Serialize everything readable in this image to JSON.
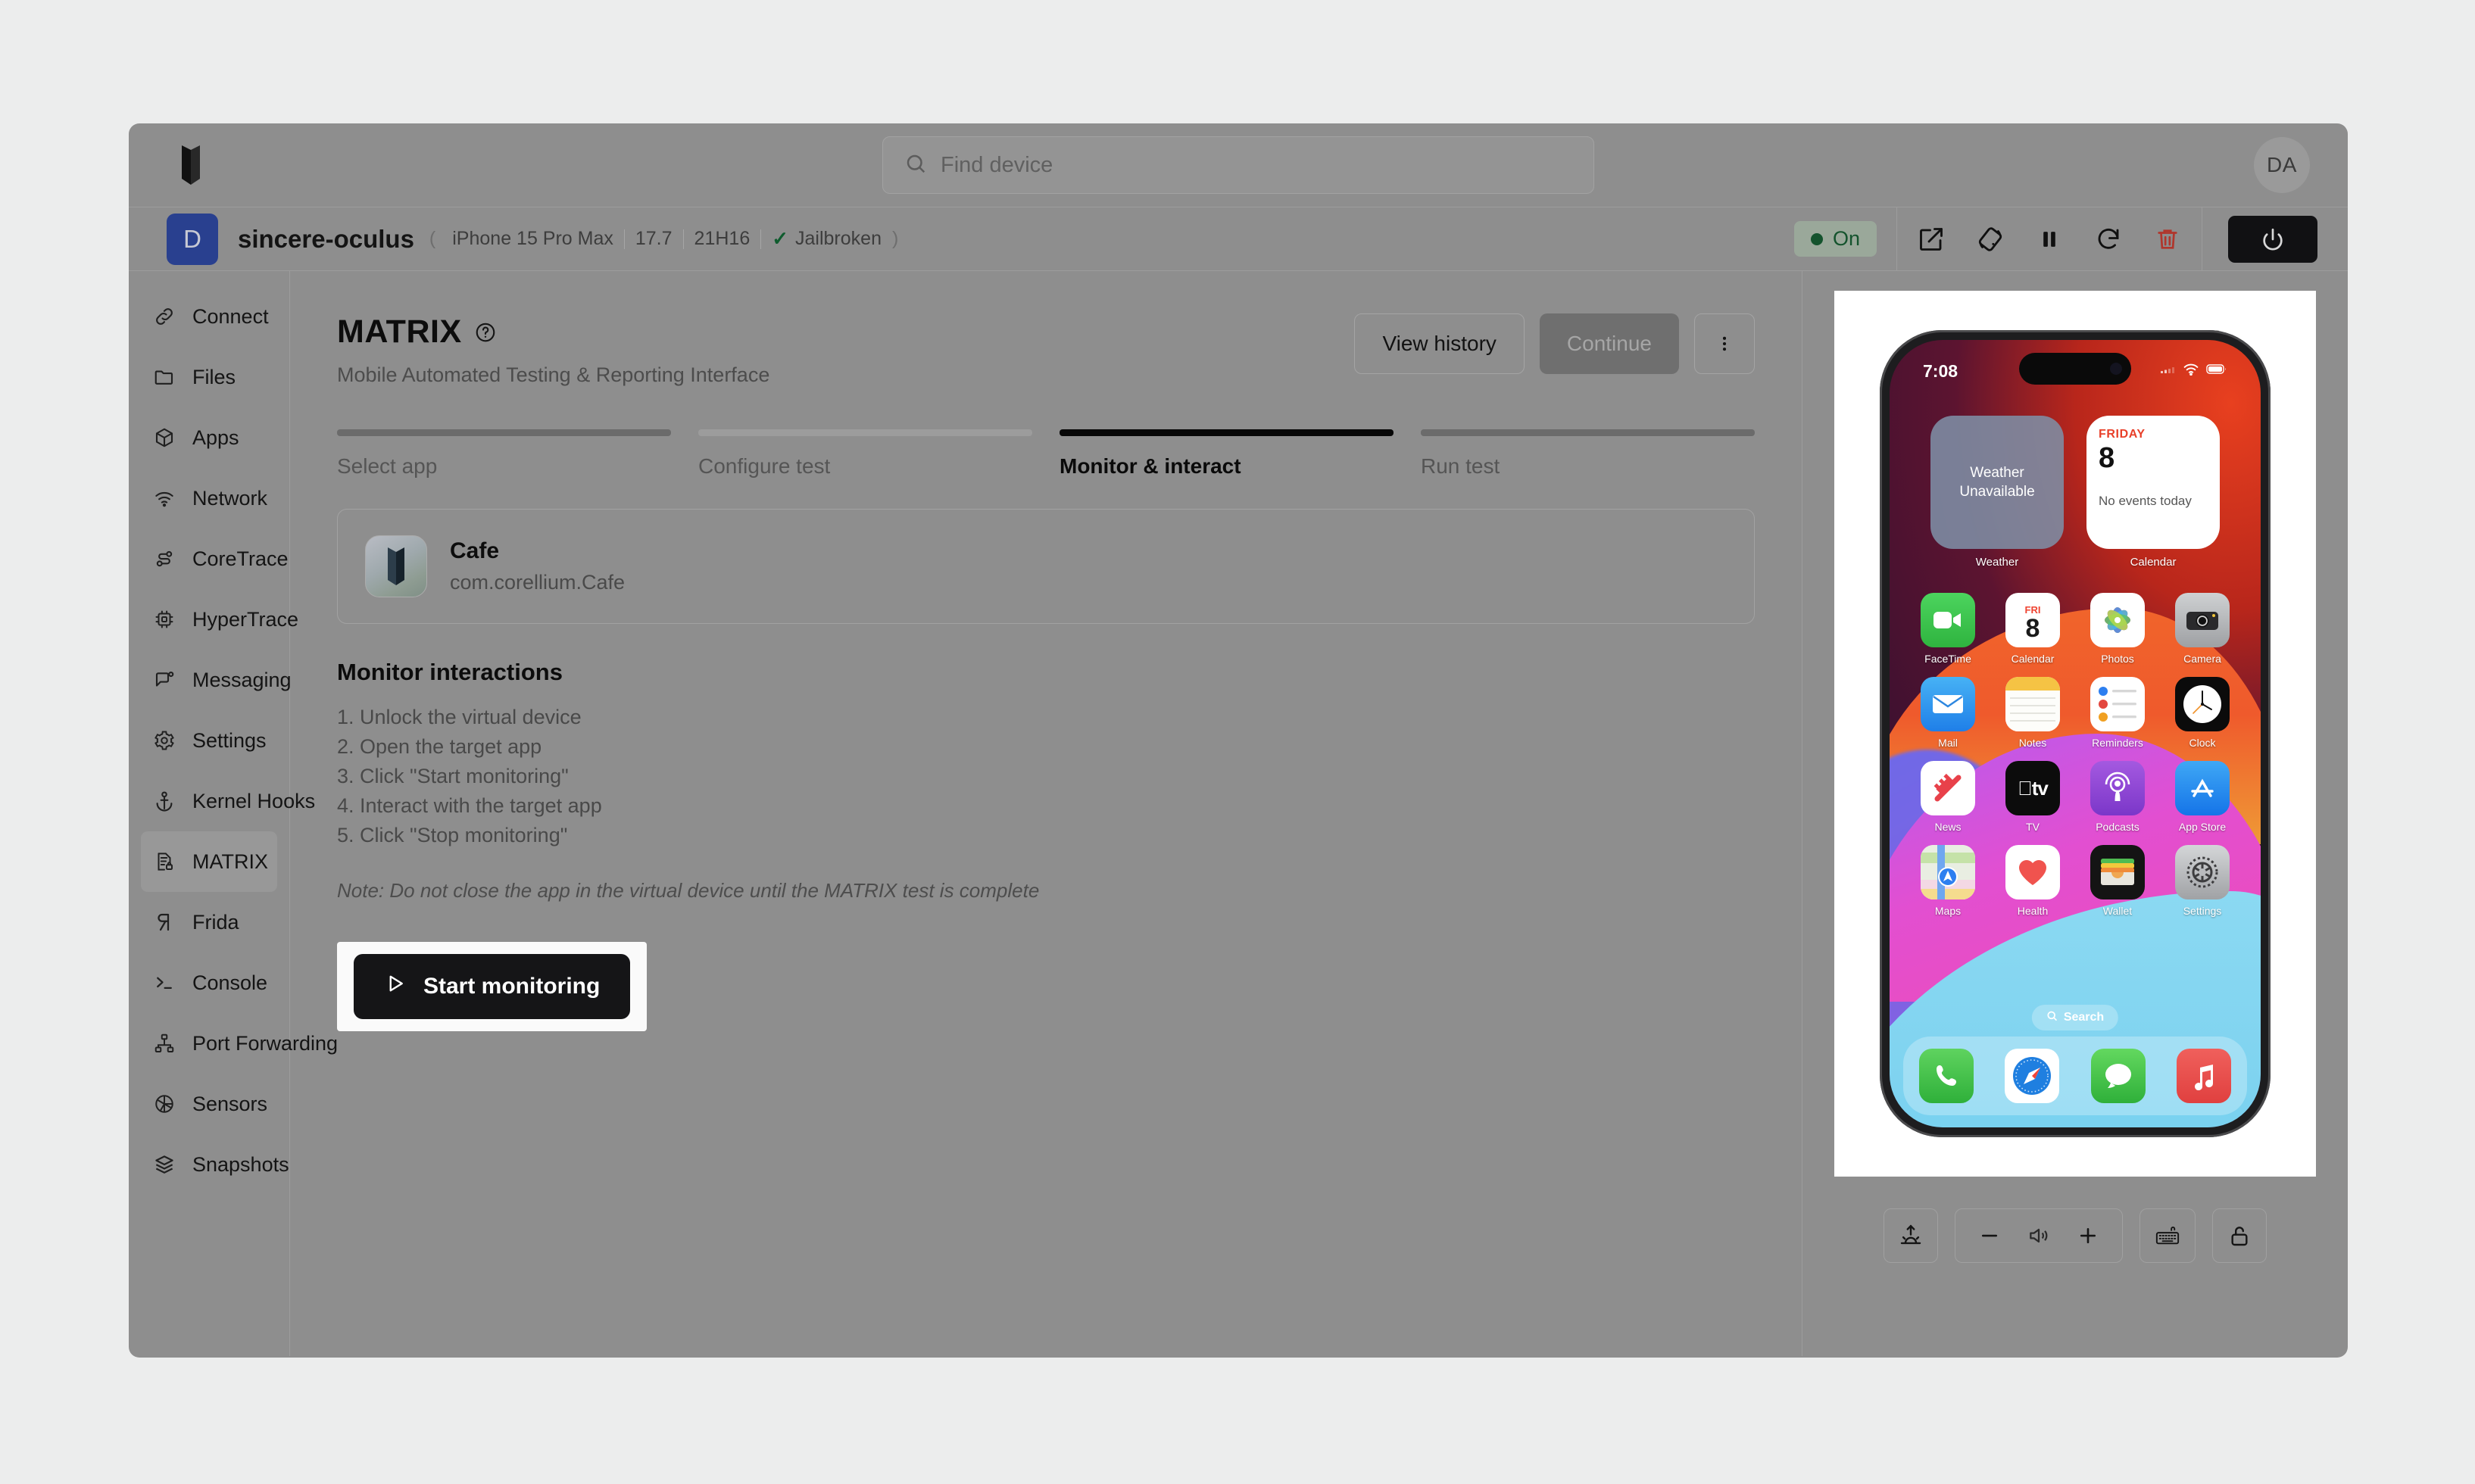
{
  "header": {
    "logo_alt": "corellium-logo",
    "search_placeholder": "Find device",
    "search_value": "",
    "avatar_initials": "DA"
  },
  "device_bar": {
    "badge_letter": "D",
    "name": "sincere-oculus",
    "model": "iPhone 15 Pro Max",
    "os_version": "17.7",
    "build": "21H16",
    "jailbroken_label": "Jailbroken",
    "jailbroken_check": "✓",
    "status_label": "On",
    "status_color": "#14532d",
    "actions": [
      {
        "name": "open-external-icon",
        "label": "Open in new window"
      },
      {
        "name": "rotate-device-icon",
        "label": "Rotate"
      },
      {
        "name": "pause-icon",
        "label": "Pause"
      },
      {
        "name": "restart-icon",
        "label": "Restart"
      },
      {
        "name": "delete-icon",
        "label": "Delete",
        "color": "#b0362c"
      }
    ],
    "power_label": "Power"
  },
  "sidebar": {
    "items": [
      {
        "label": "Connect",
        "icon": "link-icon",
        "active": false
      },
      {
        "label": "Files",
        "icon": "folder-icon",
        "active": false
      },
      {
        "label": "Apps",
        "icon": "box-icon",
        "active": false
      },
      {
        "label": "Network",
        "icon": "wifi-icon",
        "active": false
      },
      {
        "label": "CoreTrace",
        "icon": "flow-icon",
        "active": false
      },
      {
        "label": "HyperTrace",
        "icon": "chip-icon",
        "active": false
      },
      {
        "label": "Messaging",
        "icon": "chat-icon",
        "active": false
      },
      {
        "label": "Settings",
        "icon": "gear-icon",
        "active": false
      },
      {
        "label": "Kernel Hooks",
        "icon": "anchor-icon",
        "active": false
      },
      {
        "label": "MATRIX",
        "icon": "matrix-icon",
        "active": true
      },
      {
        "label": "Frida",
        "icon": "frida-icon",
        "active": false
      },
      {
        "label": "Console",
        "icon": "terminal-icon",
        "active": false
      },
      {
        "label": "Port Forwarding",
        "icon": "network-tree-icon",
        "active": false
      },
      {
        "label": "Sensors",
        "icon": "aperture-icon",
        "active": false
      },
      {
        "label": "Snapshots",
        "icon": "layers-icon",
        "active": false
      }
    ]
  },
  "main": {
    "title": "MATRIX",
    "subtitle": "Mobile Automated Testing & Reporting Interface",
    "view_history_label": "View history",
    "continue_label": "Continue",
    "kebab_label": "More options",
    "steps": [
      {
        "label": "Select app",
        "state": "done"
      },
      {
        "label": "Configure test",
        "state": "pending"
      },
      {
        "label": "Monitor & interact",
        "state": "active"
      },
      {
        "label": "Run test",
        "state": "done"
      }
    ],
    "app": {
      "name": "Cafe",
      "bundle_id": "com.corellium.Cafe"
    },
    "section_title": "Monitor interactions",
    "instructions": [
      "1. Unlock the virtual device",
      "2. Open the target app",
      "3. Click \"Start monitoring\"",
      "4. Interact with the target app",
      "5. Click \"Stop monitoring\""
    ],
    "note": "Note: Do not close the app in the virtual device until the MATRIX test is complete",
    "start_button_label": "Start monitoring"
  },
  "device_preview": {
    "status_bar": {
      "time": "7:08",
      "wifi_icon": "wifi-icon",
      "battery_icon": "battery-icon"
    },
    "widgets": [
      {
        "type": "weather",
        "text": "Weather\nUnavailable",
        "label": "Weather"
      },
      {
        "type": "calendar",
        "dow": "FRIDAY",
        "day": "8",
        "events": "No events today",
        "label": "Calendar"
      }
    ],
    "home_rows": [
      [
        {
          "label": "FaceTime",
          "icon": "facetime-icon"
        },
        {
          "label": "Calendar",
          "icon": "calendar-icon",
          "dow": "FRI",
          "day": "8"
        },
        {
          "label": "Photos",
          "icon": "photos-icon"
        },
        {
          "label": "Camera",
          "icon": "camera-icon"
        }
      ],
      [
        {
          "label": "Mail",
          "icon": "mail-icon"
        },
        {
          "label": "Notes",
          "icon": "notes-icon"
        },
        {
          "label": "Reminders",
          "icon": "reminders-icon"
        },
        {
          "label": "Clock",
          "icon": "clock-icon"
        }
      ],
      [
        {
          "label": "News",
          "icon": "news-icon"
        },
        {
          "label": "TV",
          "icon": "tv-icon"
        },
        {
          "label": "Podcasts",
          "icon": "podcasts-icon"
        },
        {
          "label": "App Store",
          "icon": "appstore-icon"
        }
      ],
      [
        {
          "label": "Maps",
          "icon": "maps-icon"
        },
        {
          "label": "Health",
          "icon": "health-icon"
        },
        {
          "label": "Wallet",
          "icon": "wallet-icon"
        },
        {
          "label": "Settings",
          "icon": "settings-icon"
        }
      ]
    ],
    "search_pill_label": "Search",
    "dock": [
      {
        "label": "Phone",
        "icon": "phone-icon"
      },
      {
        "label": "Safari",
        "icon": "safari-icon"
      },
      {
        "label": "Messages",
        "icon": "messages-icon"
      },
      {
        "label": "Music",
        "icon": "music-icon"
      }
    ],
    "controls": [
      {
        "name": "brightness-button",
        "label": "Brightness"
      },
      {
        "name": "volume-down-button",
        "label": "−"
      },
      {
        "name": "volume-icon",
        "label": "Volume"
      },
      {
        "name": "volume-up-button",
        "label": "+"
      },
      {
        "name": "keyboard-button",
        "label": "Keyboard"
      },
      {
        "name": "lock-button",
        "label": "Lock"
      }
    ]
  }
}
